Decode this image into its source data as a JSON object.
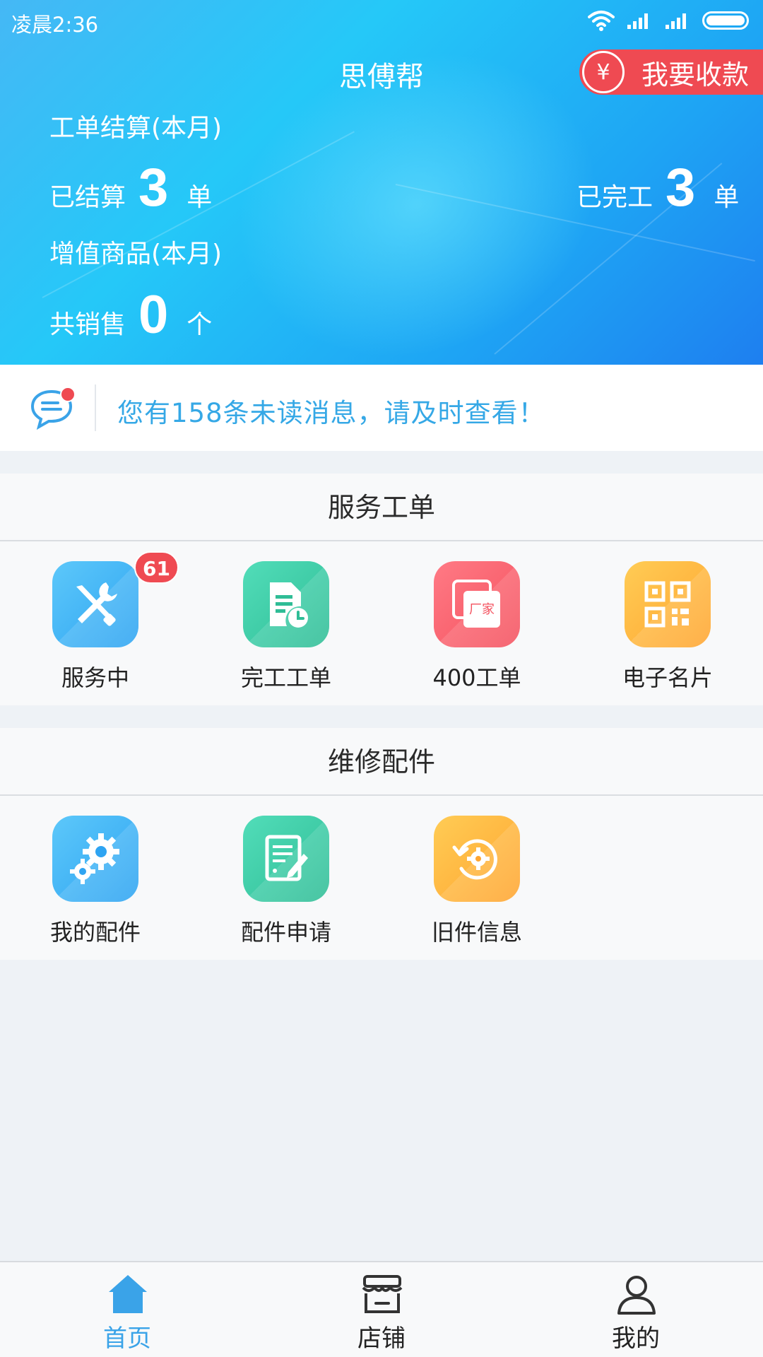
{
  "status_bar": {
    "time": "凌晨2:36"
  },
  "header": {
    "title": "思傅帮",
    "collect_button": {
      "label": "我要收款",
      "icon_symbol": "¥"
    },
    "work_order_label": "工单结算(本月)",
    "settled": {
      "prefix": "已结算",
      "value": "3",
      "unit": "单"
    },
    "completed": {
      "prefix": "已完工",
      "value": "3",
      "unit": "单"
    },
    "value_added_label": "增值商品(本月)",
    "sold": {
      "prefix": "共销售",
      "value": "0",
      "unit": "个"
    }
  },
  "notice": {
    "text": "您有158条未读消息，请及时查看！"
  },
  "service_orders": {
    "title": "服务工单",
    "items": [
      {
        "label": "服务中",
        "icon": "tools-icon",
        "badge": "61"
      },
      {
        "label": "完工工单",
        "icon": "completed-document-icon"
      },
      {
        "label": "400工单",
        "icon": "manufacturer-order-icon",
        "icon_text": "厂家"
      },
      {
        "label": "电子名片",
        "icon": "qr-code-icon"
      }
    ]
  },
  "repair_parts": {
    "title": "维修配件",
    "items": [
      {
        "label": "我的配件",
        "icon": "gears-icon"
      },
      {
        "label": "配件申请",
        "icon": "edit-form-icon"
      },
      {
        "label": "旧件信息",
        "icon": "recycle-gear-icon"
      }
    ]
  },
  "bottom_nav": {
    "items": [
      {
        "label": "首页",
        "icon": "home-icon",
        "active": true
      },
      {
        "label": "店铺",
        "icon": "store-icon",
        "active": false
      },
      {
        "label": "我的",
        "icon": "user-icon",
        "active": false
      }
    ]
  },
  "colors": {
    "accent_blue": "#3aa3e8",
    "badge_red": "#ef4a52",
    "tile_blue": "#2ea4f2",
    "tile_green": "#2fbd96",
    "tile_red": "#f4525f",
    "tile_orange": "#ffa530"
  }
}
